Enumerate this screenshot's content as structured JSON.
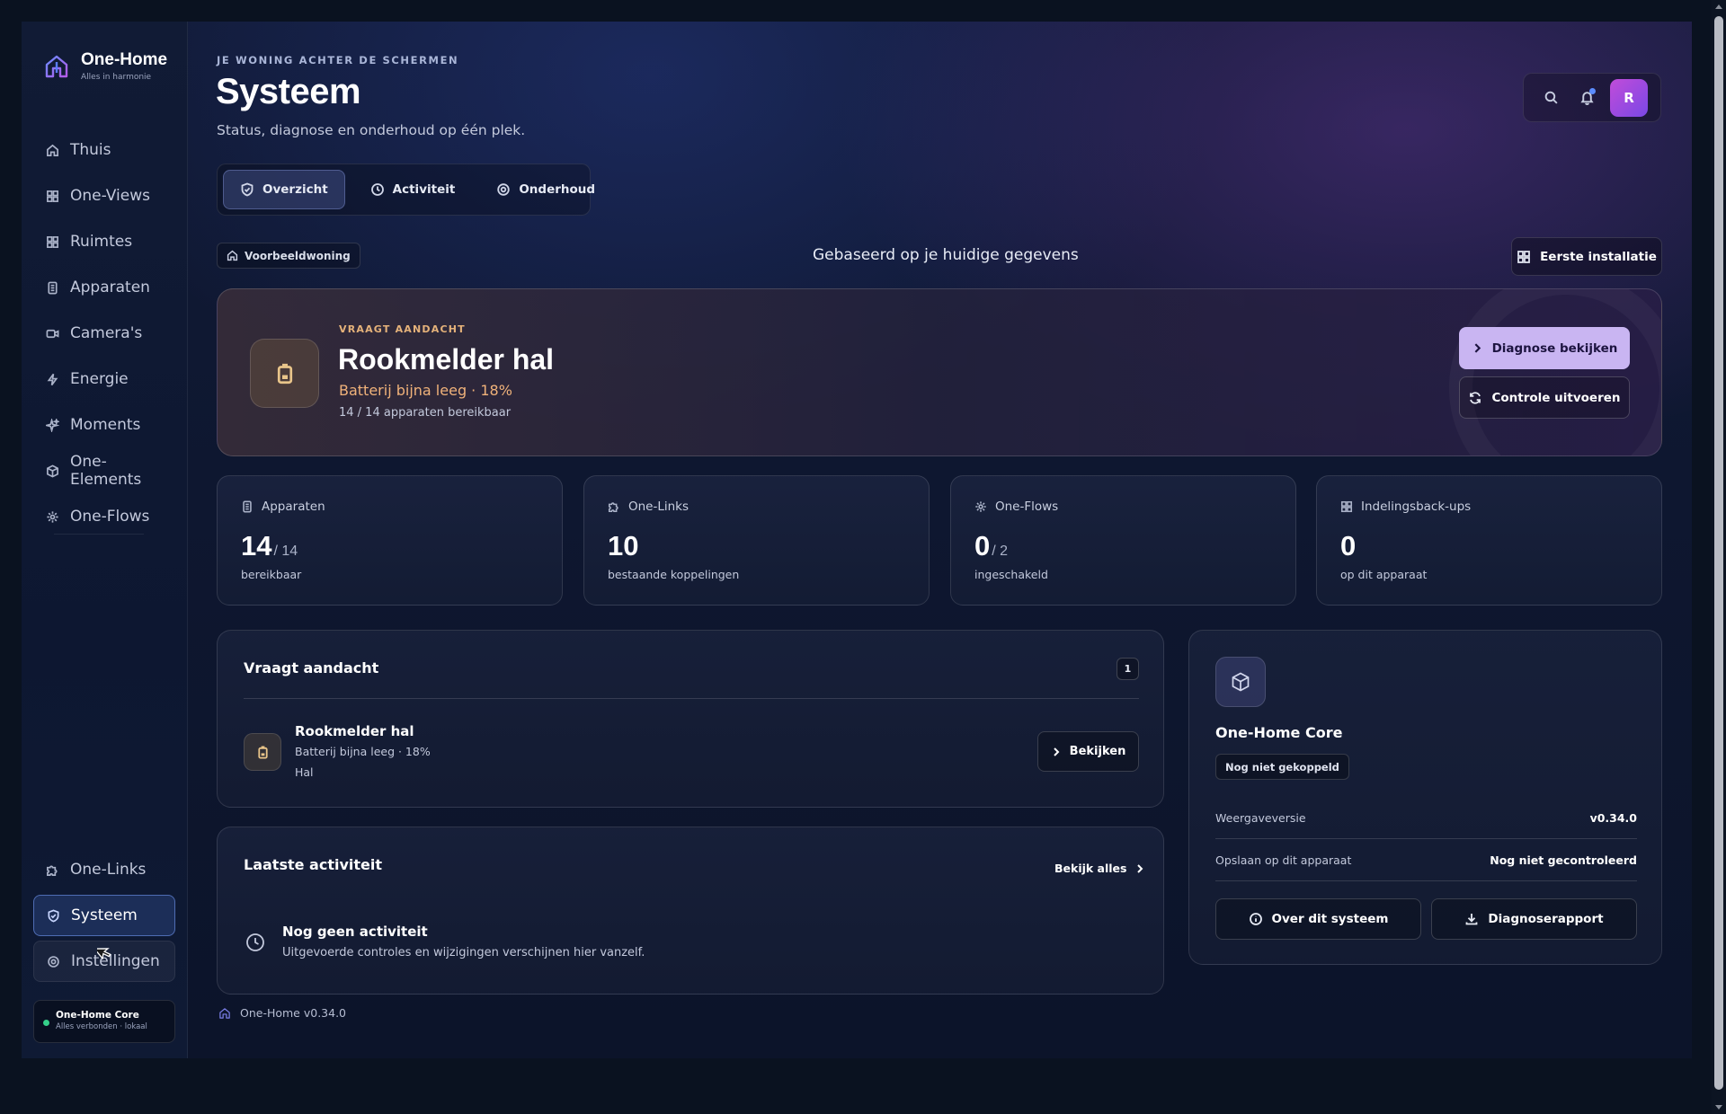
{
  "app": {
    "name": "One-Home",
    "tagline": "Alles in harmonie",
    "version_footer": "One-Home v0.34.0"
  },
  "sidebar": {
    "items": [
      {
        "label": "Thuis",
        "icon": "home-icon"
      },
      {
        "label": "One-Views",
        "icon": "grid-icon"
      },
      {
        "label": "Ruimtes",
        "icon": "grid-icon"
      },
      {
        "label": "Apparaten",
        "icon": "device-icon"
      },
      {
        "label": "Camera's",
        "icon": "camera-icon"
      },
      {
        "label": "Energie",
        "icon": "bolt-icon"
      },
      {
        "label": "Moments",
        "icon": "sparkle-icon"
      },
      {
        "label": "One-Elements",
        "icon": "cube-icon"
      },
      {
        "label": "One-Flows",
        "icon": "flow-icon"
      }
    ],
    "bottom_items": [
      {
        "label": "One-Links",
        "icon": "puzzle-icon"
      },
      {
        "label": "Systeem",
        "icon": "shield-icon",
        "active": true
      },
      {
        "label": "Instellingen",
        "icon": "gear-icon"
      }
    ],
    "core_status": {
      "title": "One-Home Core",
      "subtitle": "Alles verbonden · lokaal"
    }
  },
  "header": {
    "kicker": "JE WONING ACHTER DE SCHERMEN",
    "title": "Systeem",
    "subtitle": "Status, diagnose en onderhoud op één plek.",
    "avatar_initial": "R"
  },
  "tabs": [
    {
      "label": "Overzicht",
      "icon": "shield-icon",
      "active": true
    },
    {
      "label": "Activiteit",
      "icon": "clock-icon"
    },
    {
      "label": "Onderhoud",
      "icon": "gear-icon"
    }
  ],
  "context": {
    "home_chip": "Voorbeeldwoning",
    "based_on": "Gebaseerd op je huidige gegevens",
    "first_install": "Eerste installatie"
  },
  "hero": {
    "kicker": "VRAAGT AANDACHT",
    "title": "Rookmelder hal",
    "status": "Batterij bijna leeg · 18%",
    "meta": "14 / 14 apparaten bereikbaar",
    "primary_button": "Diagnose bekijken",
    "secondary_button": "Controle uitvoeren"
  },
  "stats": [
    {
      "label": "Apparaten",
      "icon": "device-icon",
      "value": "14",
      "of": "/ 14",
      "desc": "bereikbaar"
    },
    {
      "label": "One-Links",
      "icon": "puzzle-icon",
      "value": "10",
      "of": "",
      "desc": "bestaande koppelingen"
    },
    {
      "label": "One-Flows",
      "icon": "flow-icon",
      "value": "0",
      "of": "/ 2",
      "desc": "ingeschakeld"
    },
    {
      "label": "Indelingsback-ups",
      "icon": "grid-icon",
      "value": "0",
      "of": "",
      "desc": "op dit apparaat"
    }
  ],
  "attention": {
    "title": "Vraagt aandacht",
    "count": "1",
    "item": {
      "name": "Rookmelder hal",
      "detail": "Batterij bijna leeg · 18%",
      "room": "Hal",
      "action": "Bekijken"
    }
  },
  "activity": {
    "title": "Laatste activiteit",
    "see_all": "Bekijk alles",
    "empty_title": "Nog geen activiteit",
    "empty_desc": "Uitgevoerde controles en wijzigingen verschijnen hier vanzelf."
  },
  "core": {
    "title": "One-Home Core",
    "badge": "Nog niet gekoppeld",
    "rows": [
      {
        "key": "Weergaveversie",
        "value": "v0.34.0"
      },
      {
        "key": "Opslaan op dit apparaat",
        "value": "Nog niet gecontroleerd"
      }
    ],
    "btn_about": "Over dit systeem",
    "btn_report": "Diagnoserapport"
  },
  "colors": {
    "accent": "#c9b5f2",
    "warning": "#f0b27a",
    "status_ok": "#35d08a",
    "avatar_gradient_start": "#c14cd9"
  }
}
